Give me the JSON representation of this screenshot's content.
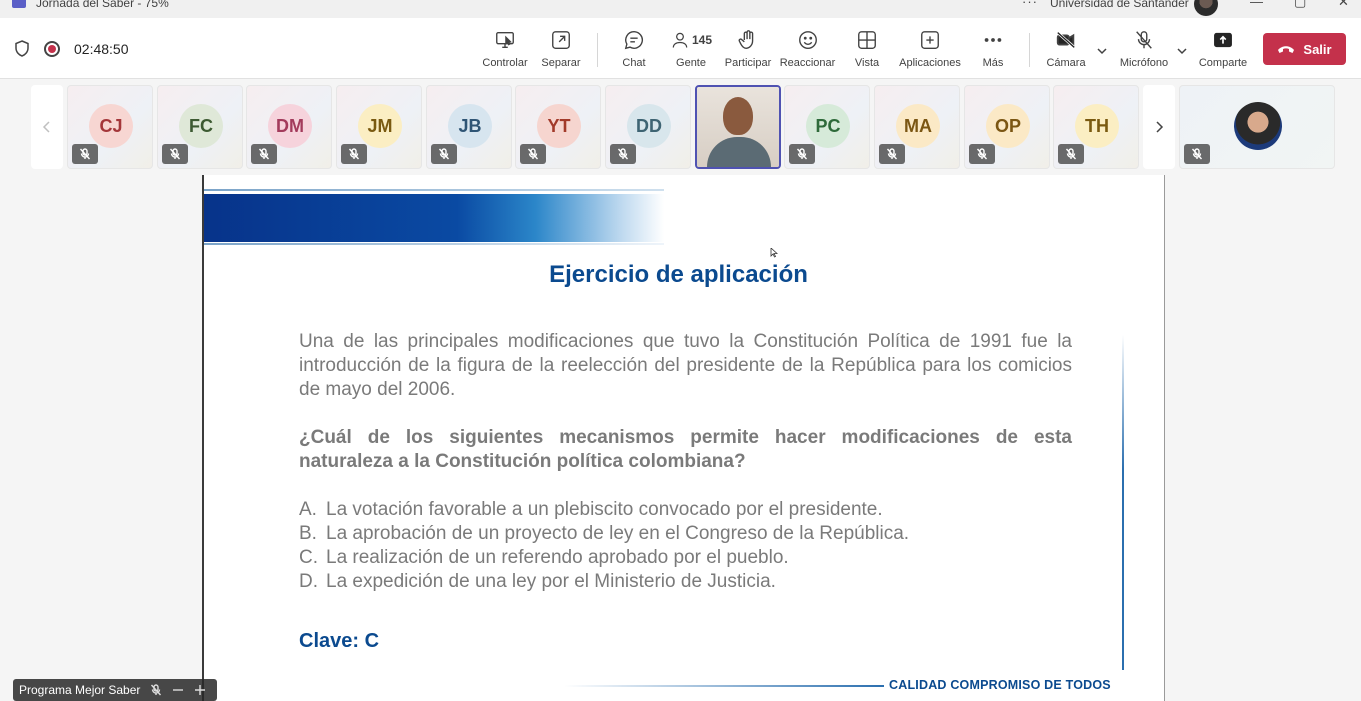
{
  "window": {
    "title": "Jornada del Saber - 75%",
    "org_name": "Universidad de Santander",
    "controls": [
      "—",
      "▢",
      "✕"
    ]
  },
  "meeting": {
    "timer": "02:48:50",
    "people_count": "145"
  },
  "toolbar": {
    "controlar": "Controlar",
    "separar": "Separar",
    "chat": "Chat",
    "gente": "Gente",
    "participar": "Participar",
    "reaccionar": "Reaccionar",
    "vista": "Vista",
    "aplicaciones": "Aplicaciones",
    "mas": "Más",
    "camara": "Cámara",
    "microfono": "Micrófono",
    "comparte": "Comparte",
    "salir": "Salir"
  },
  "participants": [
    {
      "initials": "CJ",
      "bg": "#f7d6d2",
      "fg": "#a4373a"
    },
    {
      "initials": "FC",
      "bg": "#dfe8d8",
      "fg": "#3d5a32"
    },
    {
      "initials": "DM",
      "bg": "#f6d3dc",
      "fg": "#a33b5c"
    },
    {
      "initials": "JM",
      "bg": "#fbeec3",
      "fg": "#7a5a10"
    },
    {
      "initials": "JB",
      "bg": "#d7e5ef",
      "fg": "#2f5575"
    },
    {
      "initials": "YT",
      "bg": "#f6d5cf",
      "fg": "#a23a2a"
    },
    {
      "initials": "DD",
      "bg": "#d8e6ec",
      "fg": "#3e6473"
    },
    {
      "initials": "PC",
      "bg": "#d6ead9",
      "fg": "#2e6a3a"
    },
    {
      "initials": "MA",
      "bg": "#fbe9c6",
      "fg": "#7b5613"
    },
    {
      "initials": "OP",
      "bg": "#fbe9c6",
      "fg": "#7b5613"
    },
    {
      "initials": "TH",
      "bg": "#fbeec3",
      "fg": "#7a5a10"
    }
  ],
  "slide": {
    "heading": "Ejercicio de aplicación",
    "paragraph": "Una de las principales modificaciones que tuvo la Constitución Política de 1991 fue la introducción de la figura de la reelección del presidente de la República para los comicios de mayo del 2006.",
    "question": "¿Cuál de los siguientes mecanismos permite hacer modificaciones de esta naturaleza a la Constitución política colombiana?",
    "options": [
      {
        "letter": "A.",
        "text": "La votación favorable a un plebiscito convocado por el presidente."
      },
      {
        "letter": "B.",
        "text": "La aprobación de un proyecto de ley en el Congreso de la República."
      },
      {
        "letter": "C.",
        "text": "La realización de un referendo aprobado por el pueblo."
      },
      {
        "letter": "D.",
        "text": "La expedición de una ley por el Ministerio de Justicia."
      }
    ],
    "answer": "Clave: C",
    "footer": "CALIDAD COMPROMISO DE TODOS"
  },
  "presenter": {
    "name": "Programa Mejor Saber"
  },
  "colors": {
    "leave": "#c4314b",
    "accent": "#4f52b2",
    "slide_blue": "#0b4a8f"
  }
}
